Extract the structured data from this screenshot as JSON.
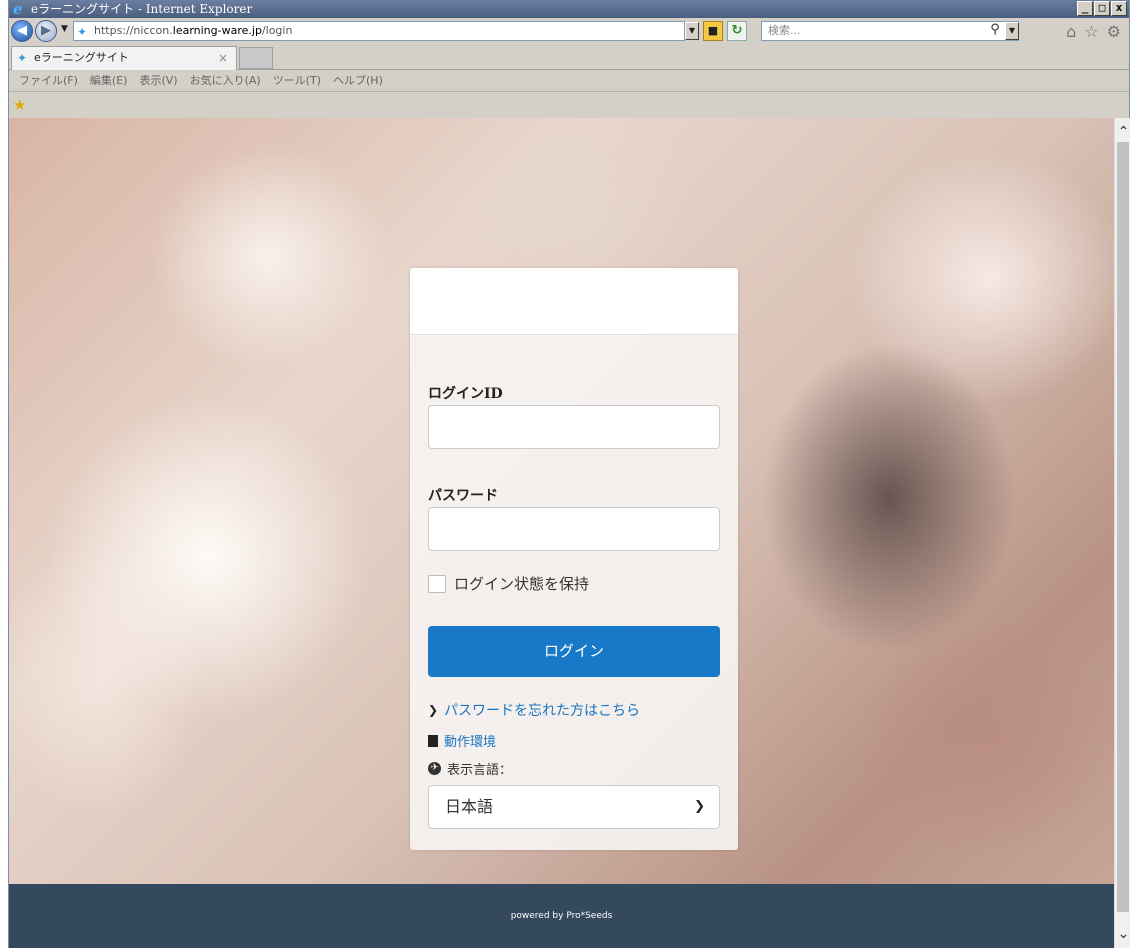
{
  "window": {
    "title": "eラーニングサイト - Internet Explorer",
    "buttons": [
      "_",
      "□",
      "x"
    ]
  },
  "address_bar": {
    "url_prefix": "https://niccon.",
    "url_host": "learning-ware.jp",
    "url_path": "/login",
    "search_placeholder": "検索..."
  },
  "tab": {
    "label": "eラーニングサイト",
    "close": "×"
  },
  "menu": [
    "ファイル(F)",
    "編集(E)",
    "表示(V)",
    "お気に入り(A)",
    "ツール(T)",
    "ヘルプ(H)"
  ],
  "login": {
    "id_label": "ログインID",
    "id_placeholder": "",
    "password_label": "パスワード",
    "remember_label": "ログイン状態を保持",
    "login_button": "ログイン",
    "forgot_link": "パスワードを忘れた方はこちら",
    "env_link": "動作環境",
    "lang_label": "表示言語：",
    "lang_value": "日本語"
  },
  "footer": {
    "text": "powered by Pro*Seeds"
  },
  "colors": {
    "primary": "#1879c8",
    "link": "#1a74c2",
    "footer_bg": "#34495e"
  }
}
